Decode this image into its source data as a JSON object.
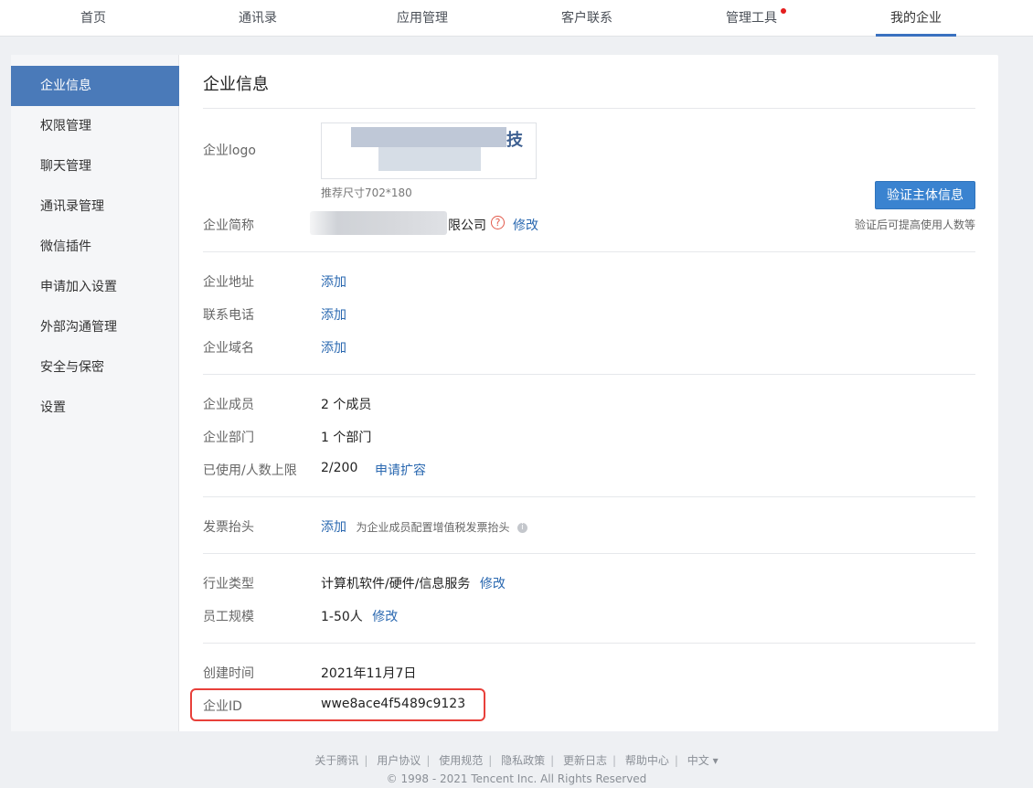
{
  "topnav": {
    "items": [
      "首页",
      "通讯录",
      "应用管理",
      "客户联系",
      "管理工具",
      "我的企业"
    ],
    "active": "我的企业",
    "badge_item": "管理工具",
    "badge_color": "#e41e1e"
  },
  "sidebar": {
    "items": [
      "企业信息",
      "权限管理",
      "聊天管理",
      "通讯录管理",
      "微信插件",
      "申请加入设置",
      "外部沟通管理",
      "安全与保密",
      "设置"
    ],
    "active": "企业信息"
  },
  "page_title": "企业信息",
  "logo": {
    "label": "企业logo",
    "hint": "推荐尺寸702*180",
    "visible_glyph_left": "",
    "visible_glyph_right": "技"
  },
  "verify": {
    "button": "验证主体信息",
    "tip": "验证后可提高使用人数等"
  },
  "short_name": {
    "label": "企业简称",
    "suffix": "限公司",
    "help": "?",
    "edit": "修改"
  },
  "address": {
    "label": "企业地址",
    "action": "添加"
  },
  "phone": {
    "label": "联系电话",
    "action": "添加"
  },
  "domain": {
    "label": "企业域名",
    "action": "添加"
  },
  "members": {
    "label": "企业成员",
    "value": "2 个成员"
  },
  "departments": {
    "label": "企业部门",
    "value": "1 个部门"
  },
  "usage": {
    "label": "已使用/人数上限",
    "value": "2/200",
    "action": "申请扩容"
  },
  "invoice": {
    "label": "发票抬头",
    "action": "添加",
    "desc": "为企业成员配置增值税发票抬头",
    "info": "i"
  },
  "industry": {
    "label": "行业类型",
    "value": "计算机软件/硬件/信息服务",
    "edit": "修改"
  },
  "scale": {
    "label": "员工规模",
    "value": "1-50人",
    "edit": "修改"
  },
  "created": {
    "label": "创建时间",
    "value": "2021年11月7日"
  },
  "corp_id": {
    "label": "企业ID",
    "value": "wwe8ace4f5489c9123"
  },
  "footer": {
    "links": [
      "关于腾讯",
      "用户协议",
      "使用规范",
      "隐私政策",
      "更新日志",
      "帮助中心",
      "中文 ▾"
    ],
    "copyright": "© 1998 - 2021 Tencent Inc. All Rights Reserved"
  },
  "colors": {
    "accent": "#4a7ab9",
    "link": "#2a68b0",
    "highlight": "#e8403a"
  }
}
